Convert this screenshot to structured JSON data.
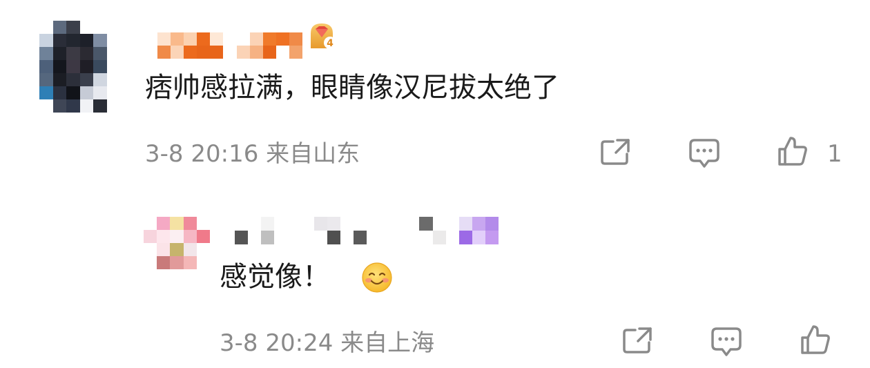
{
  "comments": [
    {
      "text": "痞帅感拉满，眼睛像汉尼拔太绝了",
      "date": "3-8",
      "time": "20:16",
      "location": "来自山东",
      "likes": "1",
      "icons": {
        "share": "share-icon",
        "reply": "comment-icon",
        "like": "thumbs-up-icon",
        "badge": "crown-level-4-badge-icon"
      }
    },
    {
      "text": "感觉像！",
      "emoji": "smiling-face-emoji",
      "date": "3-8",
      "time": "20:24",
      "location": "来自上海",
      "icons": {
        "share": "share-icon",
        "reply": "comment-icon",
        "like": "thumbs-up-icon"
      }
    }
  ],
  "colors": {
    "text": "#1a1a1a",
    "meta": "#8a8a8a",
    "icon": "#8a8a8a",
    "username_orange": "#f07a2a",
    "username_purple": "#b38bea"
  }
}
